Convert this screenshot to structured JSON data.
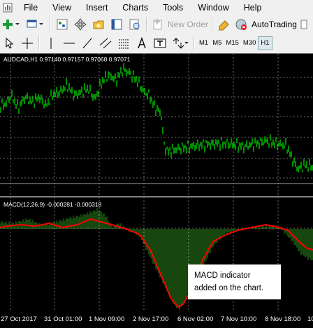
{
  "menu": [
    "File",
    "View",
    "Insert",
    "Charts",
    "Tools",
    "Window",
    "Help"
  ],
  "toolbar": {
    "new_order": "New Order",
    "autotrading": "AutoTrading",
    "timeframes": [
      "M1",
      "M5",
      "M15",
      "M30",
      "H1"
    ]
  },
  "chart": {
    "price_title": "AUDCAD,H1  0.97140 0.97157 0.97068 0.97071",
    "macd_title": "MACD(12,26,9) -0.000281 -0.000318",
    "callout_line1": "MACD indicator",
    "callout_line2": "added on the chart.",
    "time_labels": [
      "27 Oct 2017",
      "31 Oct 01:00",
      "1 Nov 09:00",
      "2 Nov 17:00",
      "6 Nov 02:00",
      "7 Nov 10:00",
      "8 Nov 18:00",
      "10"
    ],
    "colors": {
      "price": "#00c800",
      "macd_hist": "#2e8b1e",
      "signal": "#ff0000",
      "grid": "#6e6e6e"
    }
  }
}
